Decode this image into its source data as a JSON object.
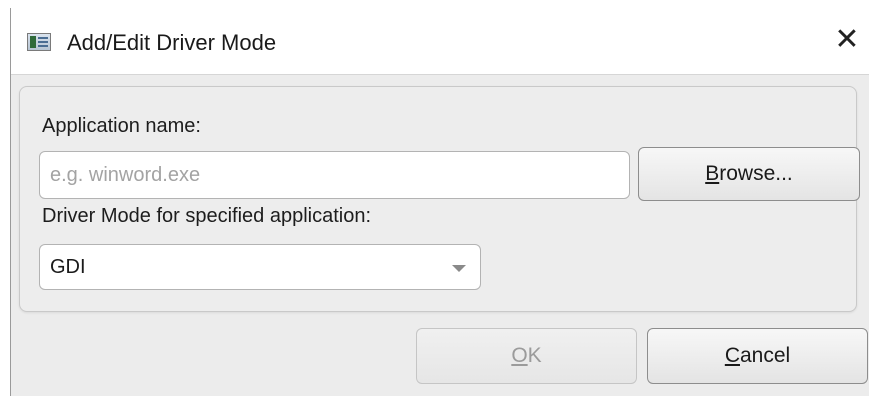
{
  "window": {
    "title": "Add/Edit Driver Mode",
    "close_glyph": "✕",
    "icon": "app-window-icon"
  },
  "form": {
    "app_name_label": "Application name:",
    "app_name_placeholder": "e.g. winword.exe",
    "app_name_value": "",
    "browse": {
      "mnemonic": "B",
      "rest": "rowse..."
    },
    "driver_mode_label": "Driver Mode for specified application:",
    "driver_mode_value": "GDI"
  },
  "buttons": {
    "ok": {
      "mnemonic": "O",
      "rest": "K",
      "enabled": false
    },
    "cancel": {
      "mnemonic": "C",
      "rest": "ancel",
      "enabled": true
    }
  }
}
